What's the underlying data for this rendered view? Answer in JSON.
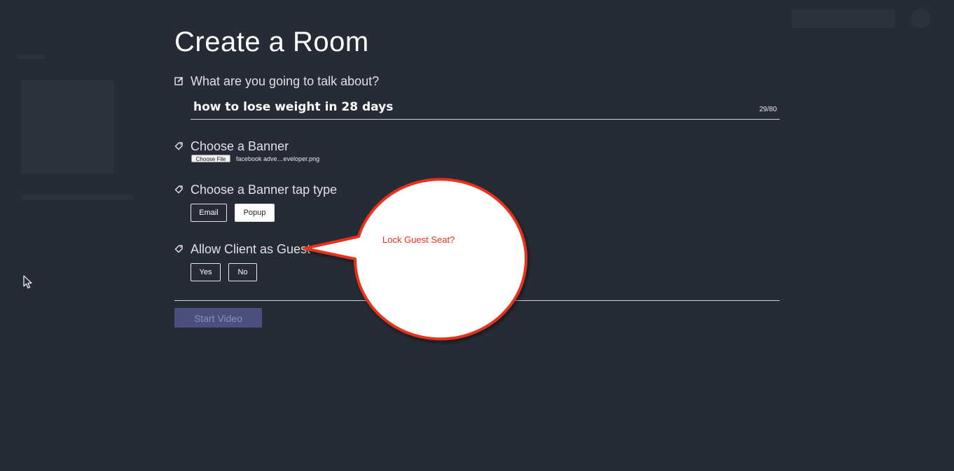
{
  "modal": {
    "title": "Create a Room",
    "topic": {
      "label": "What are you going to talk about?",
      "value": "how to lose weight in 28 days",
      "counter": "29/80"
    },
    "banner": {
      "label": "Choose a Banner",
      "choose_file_label": "Choose File",
      "file_name": "facebook adve…eveloper.png"
    },
    "banner_tap_type": {
      "label": "Choose a Banner tap type",
      "options": [
        "Email",
        "Popup"
      ],
      "selected": "Popup"
    },
    "allow_client_as_guest": {
      "label": "Allow Client as Guest",
      "options": [
        "Yes",
        "No"
      ]
    },
    "start_button": "Start Video"
  },
  "annotation": {
    "text": "Lock Guest Seat?",
    "color": "#e8321c"
  },
  "colors": {
    "background": "#262b35",
    "start_button_bg": "#4c4f7e",
    "text": "#ffffff"
  }
}
